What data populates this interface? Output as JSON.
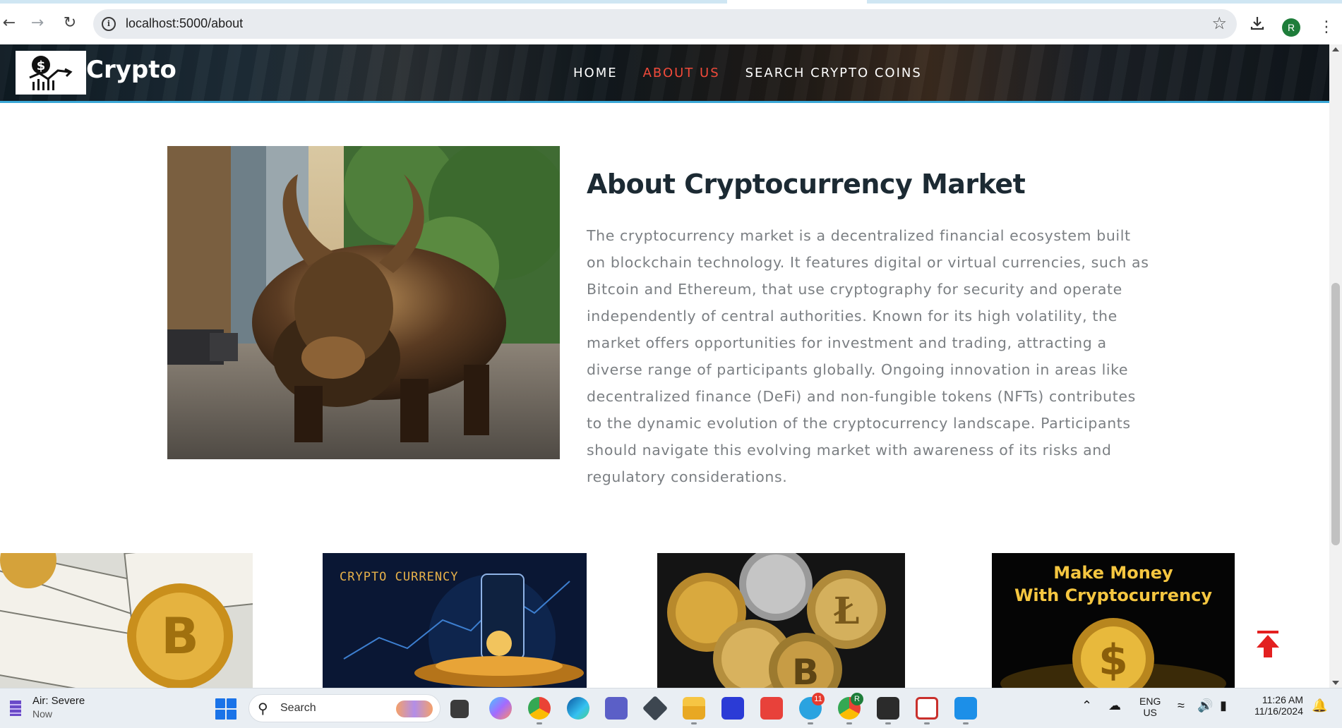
{
  "browser": {
    "url": "localhost:5000/about",
    "profile_initial": "R"
  },
  "site": {
    "brand": "Crypto",
    "nav": [
      {
        "label": "HOME",
        "active": false
      },
      {
        "label": "ABOUT US",
        "active": true
      },
      {
        "label": "SEARCH CRYPTO COINS",
        "active": false
      }
    ]
  },
  "about": {
    "title": "About Cryptocurrency Market",
    "body": "The cryptocurrency market is a decentralized financial ecosystem built on blockchain technology. It features digital or virtual currencies, such as Bitcoin and Ethereum, that use cryptography for security and operate independently of central authorities. Known for its high volatility, the market offers opportunities for investment and trading, attracting a diverse range of participants globally. Ongoing innovation in areas like decentralized finance (DeFi) and non-fungible tokens (NFTs) contributes to the dynamic evolution of the cryptocurrency landscape. Participants should navigate this evolving market with awareness of its risks and regulatory considerations."
  },
  "cards": {
    "card2_caption": "CRYPTO CURRENCY",
    "card4_caption_line1": "Make Money",
    "card4_caption_line2": "With Cryptocurrency"
  },
  "colors": {
    "nav_active": "#f04a3a",
    "header_accent": "#3aa7d6",
    "back_to_top": "#e32020"
  },
  "taskbar": {
    "weather_title": "Air: Severe",
    "weather_sub": "Now",
    "search_label": "Search",
    "telegram_badge": "11",
    "chrome_profile_badge": "R",
    "language_line1": "ENG",
    "language_line2": "US",
    "time": "11:26 AM",
    "date": "11/16/2024"
  }
}
